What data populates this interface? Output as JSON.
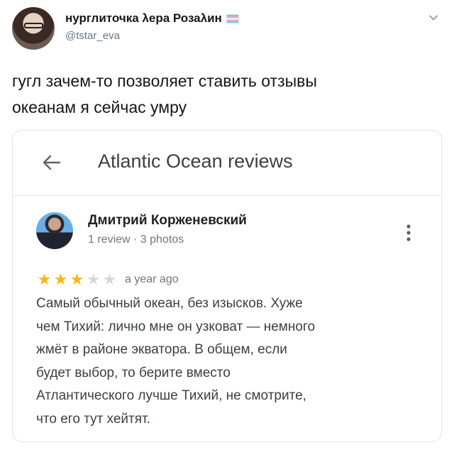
{
  "tweet": {
    "display_name": "нурглиточка λера Розаλин",
    "handle": "@tstar_eva",
    "text": "гугл зачем-то позволяет ставить отзывы\nокеанам я сейчас умру",
    "flag_icon": "transgender-flag-icon",
    "menu_icon": "chevron-down-icon"
  },
  "card": {
    "title": "Atlantic Ocean reviews",
    "back_icon": "arrow-left-icon",
    "review": {
      "author": "Дмитрий Корженевский",
      "meta": "1 review · 3 photos",
      "rating": 3,
      "rating_max": 5,
      "time": "a year ago",
      "text": "Самый обычный океан, без изысков. Хуже\nчем Тихий: лично мне он узковат — немного\nжмёт в районе экватора. В общем, если\nбудет выбор, то берите вместо\nАтлантического лучше Тихий, не смотрите,\nчто его тут хейтят.",
      "menu_icon": "more-vertical-icon"
    }
  },
  "colors": {
    "star_filled": "#f8b41c",
    "star_empty": "#d7d7d7",
    "secondary_text": "#70757a",
    "handle_text": "#657786"
  }
}
